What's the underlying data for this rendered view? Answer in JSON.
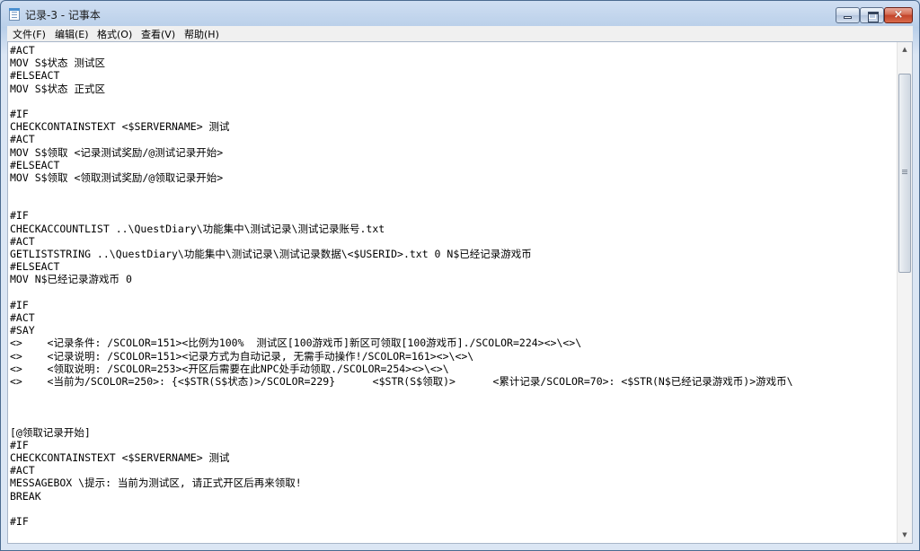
{
  "window": {
    "title": "记录-3 - 记事本",
    "controls": {
      "minimize": "minimize",
      "maximize": "maximize",
      "close": "×"
    }
  },
  "menu": [
    "文件(F)",
    "编辑(E)",
    "格式(O)",
    "查看(V)",
    "帮助(H)"
  ],
  "content": {
    "lines": [
      "#ACT",
      "MOV S$状态 测试区",
      "#ELSEACT",
      "MOV S$状态 正式区",
      "",
      "#IF",
      "CHECKCONTAINSTEXT <$SERVERNAME> 测试",
      "#ACT",
      "MOV S$领取 <记录测试奖励/@测试记录开始>",
      "#ELSEACT",
      "MOV S$领取 <领取测试奖励/@领取记录开始>",
      "",
      "",
      "#IF",
      "CHECKACCOUNTLIST ..\\QuestDiary\\功能集中\\测试记录\\测试记录账号.txt",
      "#ACT",
      "GETLISTSTRING ..\\QuestDiary\\功能集中\\测试记录\\测试记录数据\\<$USERID>.txt 0 N$已经记录游戏币",
      "#ELSEACT",
      "MOV N$已经记录游戏币 0",
      "",
      "#IF",
      "#ACT",
      "#SAY",
      "<>    <记录条件: /SCOLOR=151><比例为100%  测试区[100游戏币]新区可领取[100游戏币]./SCOLOR=224><>\\<>\\",
      "<>    <记录说明: /SCOLOR=151><记录方式为自动记录, 无需手动操作!/SCOLOR=161><>\\<>\\",
      "<>    <领取说明: /SCOLOR=253><开区后需要在此NPC处手动领取./SCOLOR=254><>\\<>\\",
      "<>    <当前为/SCOLOR=250>: {<$STR(S$状态)>/SCOLOR=229}      <$STR(S$领取)>      <累计记录/SCOLOR=70>: <$STR(N$已经记录游戏币)>游戏币\\",
      "",
      "",
      "",
      "[@领取记录开始]",
      "#IF",
      "CHECKCONTAINSTEXT <$SERVERNAME> 测试",
      "#ACT",
      "MESSAGEBOX \\提示: 当前为测试区, 请正式开区后再来领取!",
      "BREAK",
      "",
      "#IF"
    ]
  },
  "scrollbar": {
    "up": "▲",
    "down": "▼"
  }
}
